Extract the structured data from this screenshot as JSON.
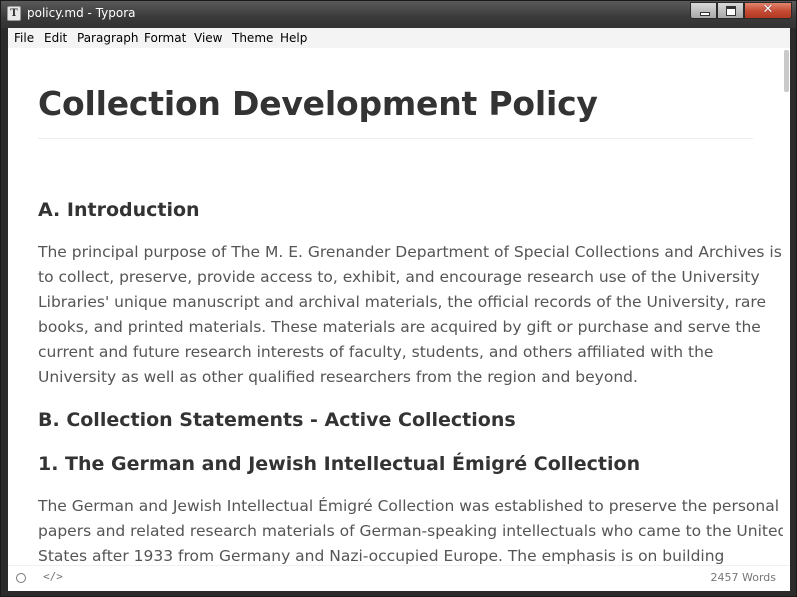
{
  "window": {
    "title": "policy.md - Typora",
    "icon": "typora-app-icon",
    "icon_glyph": "T",
    "close_glyph": "✕"
  },
  "menu": [
    "File",
    "Edit",
    "Paragraph",
    "Format",
    "View",
    "Theme",
    "Help"
  ],
  "document": {
    "title": "Collection Development Policy",
    "sections": [
      {
        "heading": "A. Introduction",
        "paragraph_lines": [
          "The principal purpose of The M. E. Grenander Department of Special Collections and Archives is",
          "to collect, preserve, provide access to, exhibit, and encourage research use of the University",
          "Libraries' unique manuscript and archival materials, the official records of the University, rare",
          "books, and printed materials. These materials are acquired by gift or purchase and serve the",
          "current and future research interests of faculty, students, and others affiliated with the",
          "University as well as other qualified researchers from the region and beyond."
        ]
      },
      {
        "heading": "B. Collection Statements - Active Collections",
        "paragraph_lines": []
      },
      {
        "heading": "1. The German and Jewish Intellectual Émigré Collection",
        "paragraph_lines": [
          "The German and Jewish Intellectual Émigré Collection was established to preserve the personal",
          "papers and related research materials of German-speaking intellectuals who came to the United",
          "States after 1933 from Germany and Nazi-occupied Europe. The emphasis is on building"
        ]
      }
    ]
  },
  "statusbar": {
    "status_icon": "circle-icon",
    "source_toggle_label": "</>",
    "word_count": "2457 Words"
  }
}
